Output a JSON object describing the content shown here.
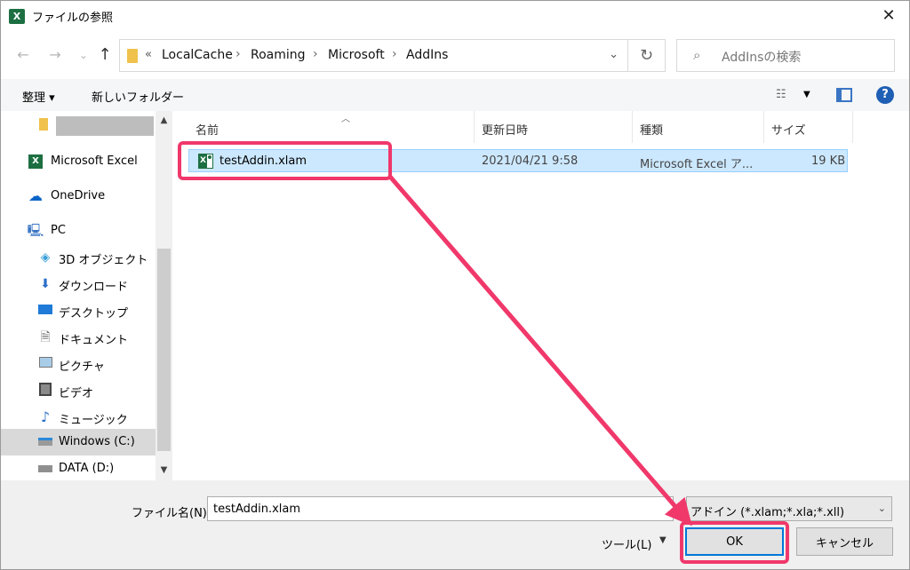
{
  "window": {
    "title": "ファイルの参照",
    "app_icon_letter": "X"
  },
  "nav": {
    "back": "←",
    "forward": "→",
    "recent": "⌄",
    "up": "↑",
    "breadcrumb_overflow": "«",
    "breadcrumbs": [
      "LocalCache",
      "Roaming",
      "Microsoft",
      "AddIns"
    ],
    "search_placeholder": "AddInsの検索"
  },
  "commands": {
    "organize": "整理 ▾",
    "new_folder": "新しいフォルダー"
  },
  "sidebar": {
    "items": [
      {
        "label": "",
        "icon": "folder-icon"
      },
      {
        "label": "Microsoft Excel",
        "icon": "excel-icon"
      },
      {
        "label": "OneDrive",
        "icon": "cloud-icon"
      },
      {
        "label": "PC",
        "icon": "computer-icon"
      },
      {
        "label": "3D オブジェクト",
        "icon": "cube-icon"
      },
      {
        "label": "ダウンロード",
        "icon": "download-icon"
      },
      {
        "label": "デスクトップ",
        "icon": "desktop-icon"
      },
      {
        "label": "ドキュメント",
        "icon": "document-icon"
      },
      {
        "label": "ピクチャ",
        "icon": "picture-icon"
      },
      {
        "label": "ビデオ",
        "icon": "video-icon"
      },
      {
        "label": "ミュージック",
        "icon": "music-icon"
      },
      {
        "label": "Windows (C:)",
        "icon": "drive-icon"
      },
      {
        "label": "DATA (D:)",
        "icon": "drive-icon"
      }
    ],
    "selected_index": 11
  },
  "filelist": {
    "columns": [
      "名前",
      "更新日時",
      "種類",
      "サイズ"
    ],
    "rows": [
      {
        "name": "testAddin.xlam",
        "modified": "2021/04/21 9:58",
        "type": "Microsoft Excel ア...",
        "size": "19 KB"
      }
    ]
  },
  "bottom": {
    "filename_label": "ファイル名(N):",
    "filename_value": "testAddin.xlam",
    "filetype_value": "アドイン (*.xlam;*.xla;*.xll)",
    "tools_label": "ツール(L)",
    "ok_label": "OK",
    "cancel_label": "キャンセル"
  },
  "colors": {
    "highlight": "#f0386b",
    "selection": "#cce8ff",
    "accent": "#0078d7"
  }
}
